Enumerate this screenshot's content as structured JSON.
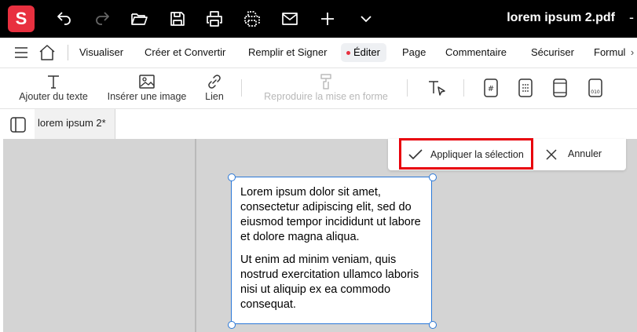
{
  "app": {
    "logo_letter": "S",
    "document_title": "lorem ipsum 2.pdf",
    "window_minimize": "-"
  },
  "titlebar_icons": [
    "undo-icon",
    "redo-icon",
    "open-folder-icon",
    "save-icon",
    "print-icon",
    "scan-icon",
    "mail-icon",
    "plus-icon",
    "chevron-down-icon"
  ],
  "menu": {
    "items": [
      "Visualiser",
      "Créer et Convertir",
      "Remplir et Signer",
      "Éditer",
      "Page",
      "Commentaire",
      "Sécuriser",
      "Formul"
    ],
    "active": "Éditer",
    "scroll_glyph": "›"
  },
  "ribbon": {
    "add_text": "Ajouter du texte",
    "insert_image": "Insérer une image",
    "link": "Lien",
    "reproduce_format": "Reproduire la mise en forme"
  },
  "tab": {
    "label": "lorem ipsum 2*"
  },
  "selection_bar": {
    "apply_label": "Appliquer la sélection",
    "cancel_label": "Annuler"
  },
  "textbox": {
    "paragraph1": "Lorem ipsum dolor sit amet, consectetur adipiscing elit, sed do eiusmod tempor incididunt ut labore et dolore magna aliqua.",
    "paragraph2": "Ut enim ad minim veniam, quis nostrud exercitation ullamco laboris nisi ut aliquip ex ea commodo consequat."
  },
  "colors": {
    "brand": "#e8303f",
    "highlight": "#e8000b",
    "selection": "#2a78d8"
  }
}
